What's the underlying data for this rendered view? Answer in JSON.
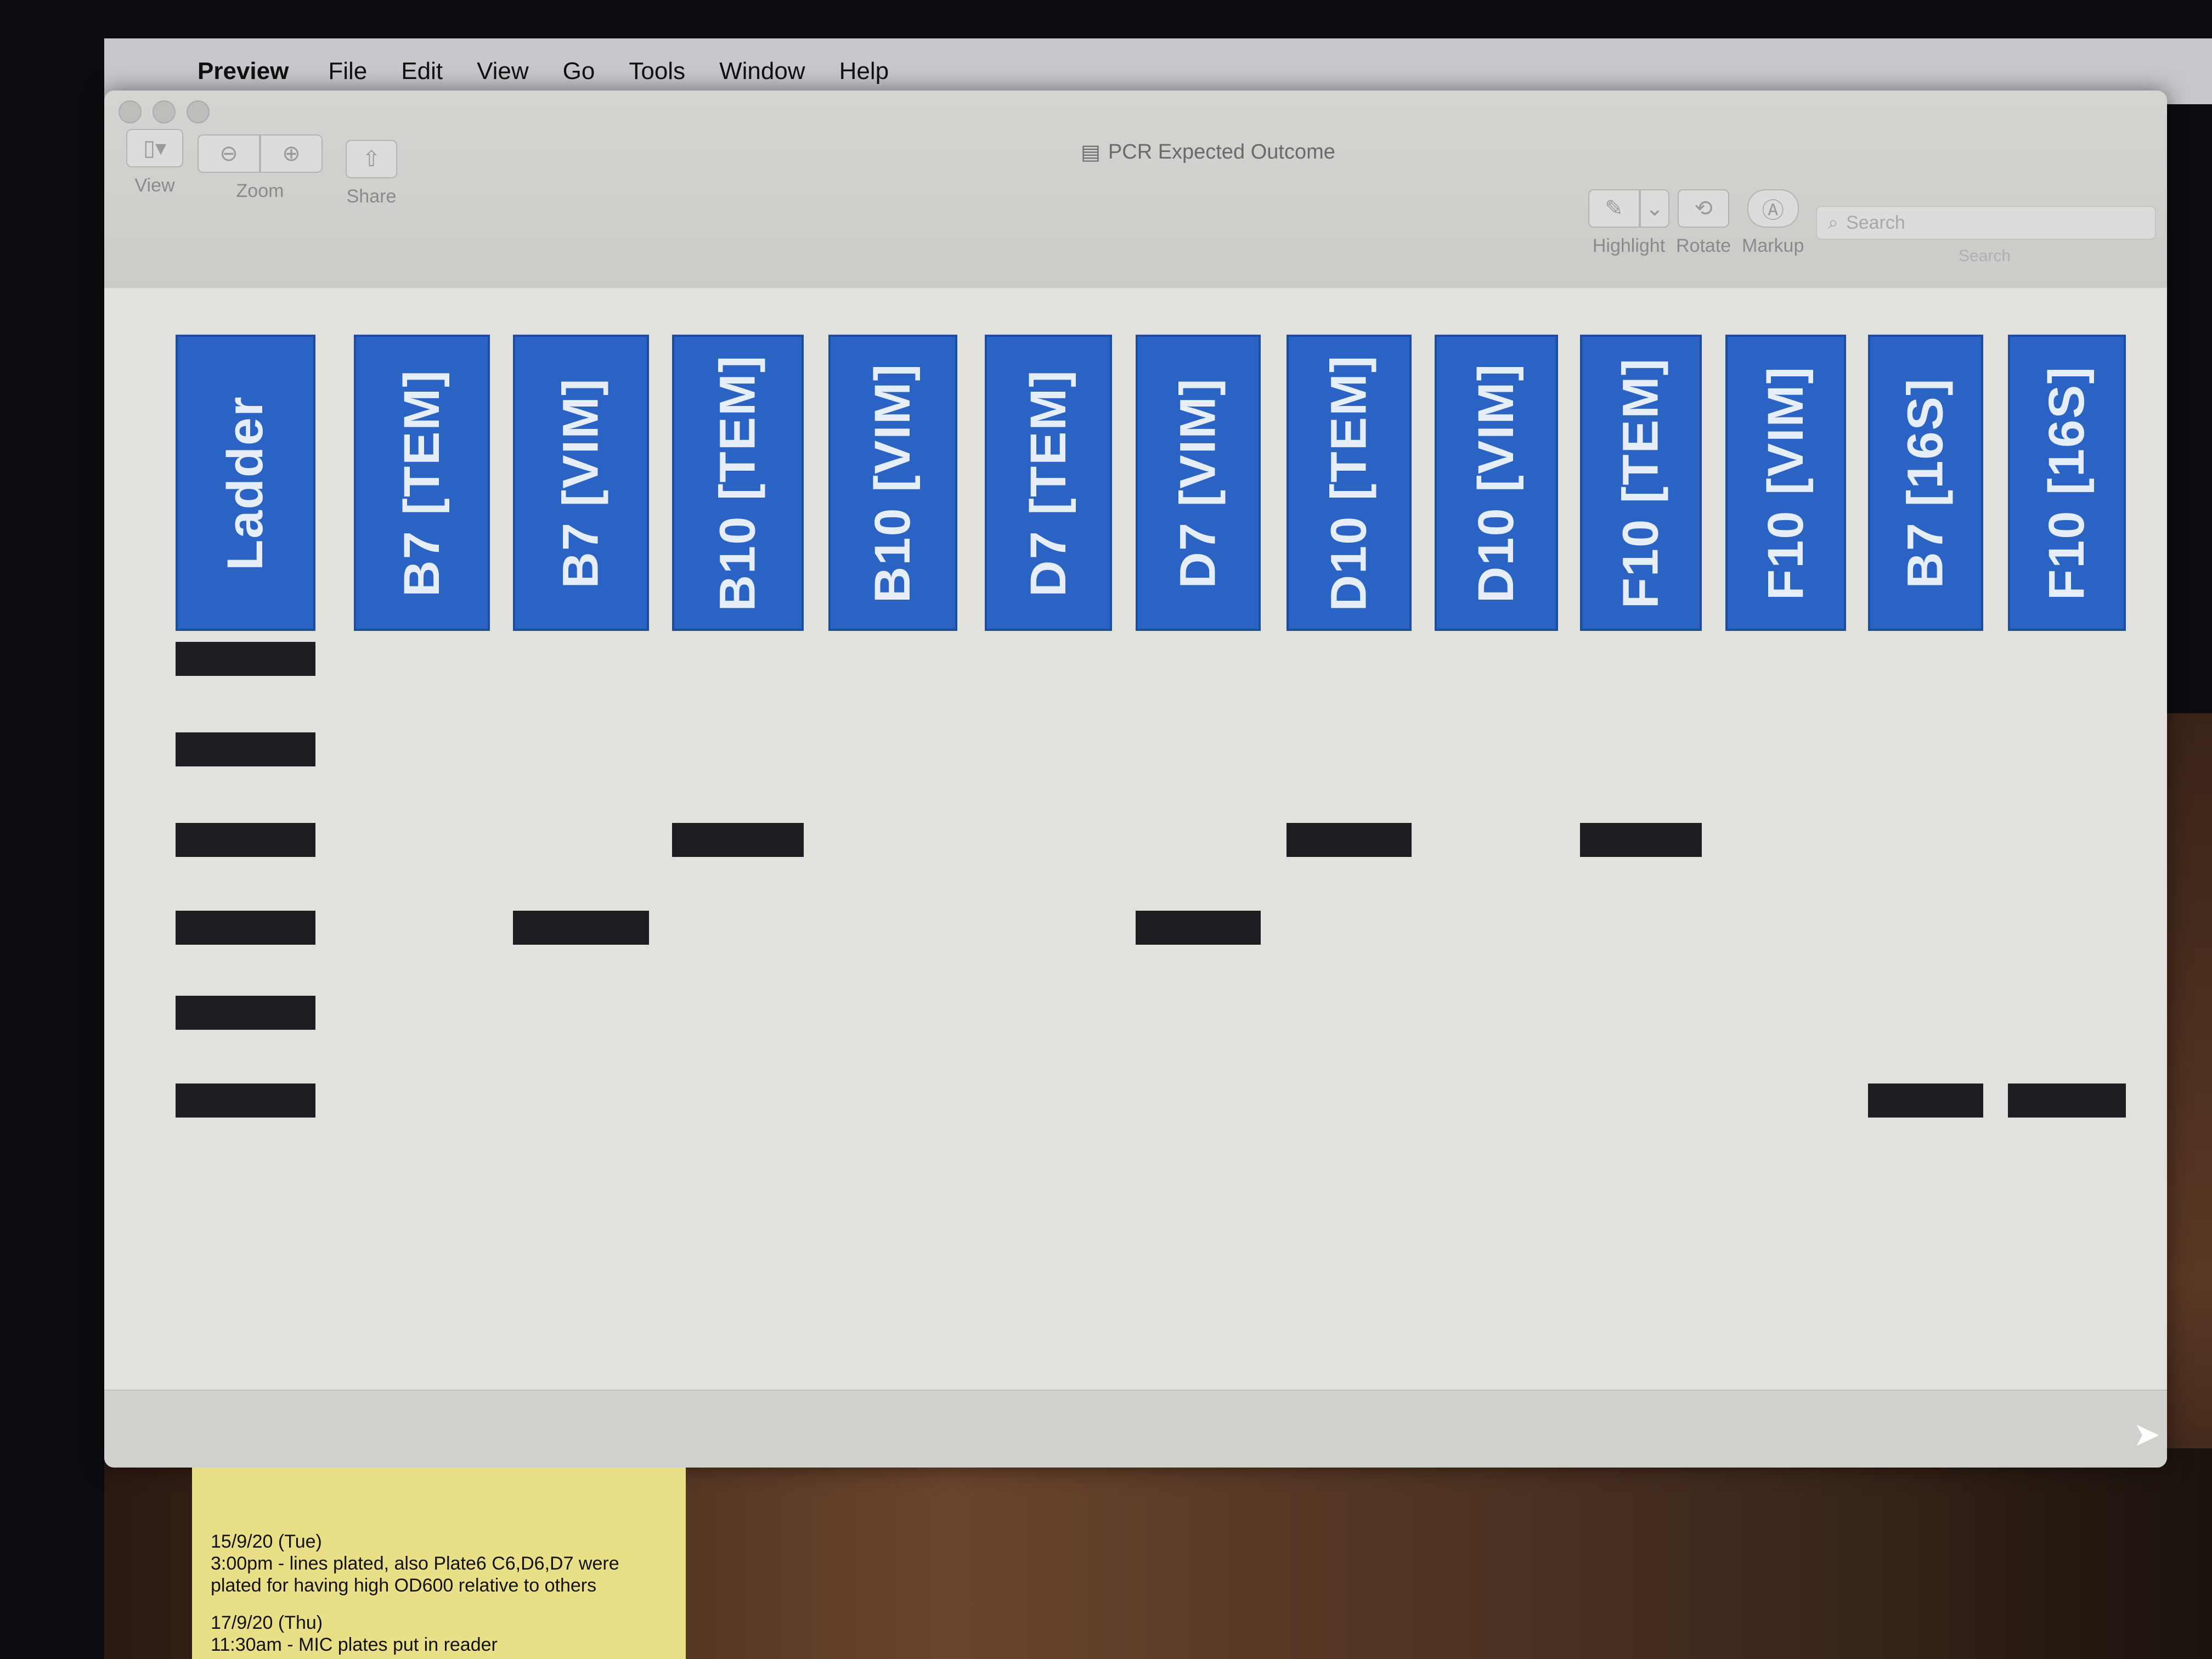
{
  "menu": {
    "app": "Preview",
    "items": [
      "File",
      "Edit",
      "View",
      "Go",
      "Tools",
      "Window",
      "Help"
    ]
  },
  "window": {
    "title": "PCR Expected Outcome",
    "toolbar": {
      "view": "View",
      "zoom": "Zoom",
      "share": "Share",
      "highlight": "Highlight",
      "rotate": "Rotate",
      "markup": "Markup",
      "search_placeholder": "Search",
      "search_caption": "Search"
    }
  },
  "gel": {
    "lanes": [
      "Ladder",
      "B7 [TEM]",
      "B7 [VIM]",
      "B10 [TEM]",
      "B10 [VIM]",
      "D7 [TEM]",
      "D7 [VIM]",
      "D10 [TEM]",
      "D10 [VIM]",
      "F10 [TEM]",
      "F10 [VIM]",
      "B7 [16S]",
      "F10 [16S]"
    ],
    "ladder_bands": [
      1,
      2,
      3,
      4,
      5,
      6
    ],
    "sample_bands": [
      {
        "lane": "B7 [VIM]",
        "level": 4
      },
      {
        "lane": "B10 [TEM]",
        "level": 3
      },
      {
        "lane": "D7 [VIM]",
        "level": 4
      },
      {
        "lane": "D10 [TEM]",
        "level": 3
      },
      {
        "lane": "F10 [TEM]",
        "level": 3
      },
      {
        "lane": "B7 [16S]",
        "level": 6
      },
      {
        "lane": "F10 [16S]",
        "level": 6
      }
    ],
    "lane_color": "#2a63c4"
  },
  "sticky": {
    "entry1_date": "15/9/20 (Tue)",
    "entry1_text": "3:00pm - lines plated, also Plate6 C6,D6,D7 were plated for having high OD600 relative to others",
    "entry2_date": "17/9/20 (Thu)",
    "entry2_text": "11:30am - MIC plates put in reader"
  }
}
